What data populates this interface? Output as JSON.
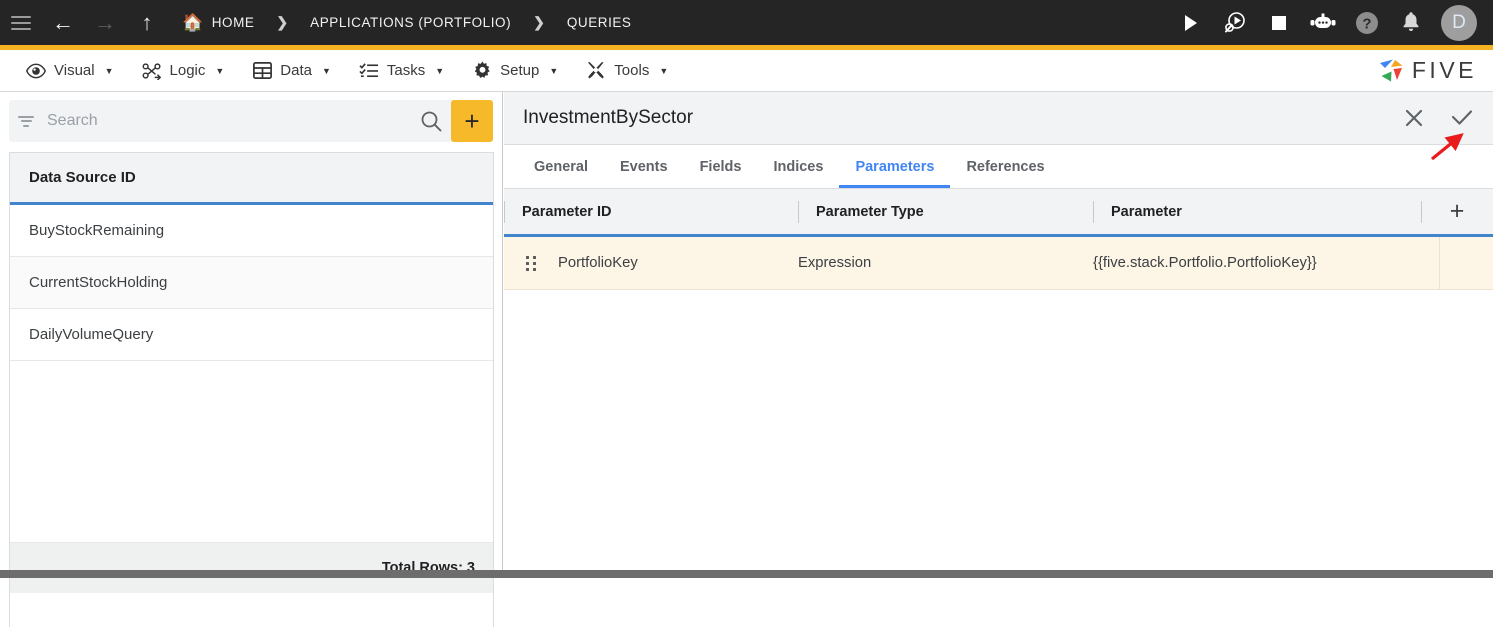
{
  "topbar": {
    "menu_icon": "hamburger-icon",
    "nav": {
      "back": "←",
      "forward": "→",
      "up": "↑"
    },
    "breadcrumb": [
      {
        "label": "HOME",
        "icon": "home-icon"
      },
      {
        "label": "APPLICATIONS (PORTFOLIO)",
        "icon": ""
      },
      {
        "label": "QUERIES",
        "icon": ""
      }
    ],
    "separator": "❯",
    "actions": [
      {
        "name": "run-icon",
        "glyph": ""
      },
      {
        "name": "debug-icon",
        "glyph": ""
      },
      {
        "name": "stop-icon",
        "glyph": ""
      },
      {
        "name": "chatbot-icon",
        "glyph": ""
      },
      {
        "name": "help-icon",
        "glyph": "?"
      },
      {
        "name": "notifications-icon",
        "glyph": ""
      }
    ],
    "avatar_initial": "D"
  },
  "menubar": {
    "items": [
      {
        "label": "Visual",
        "icon": "eye-icon",
        "caret": "▼"
      },
      {
        "label": "Logic",
        "icon": "logic-nodes-icon",
        "caret": "▼"
      },
      {
        "label": "Data",
        "icon": "table-icon",
        "caret": "▼"
      },
      {
        "label": "Tasks",
        "icon": "checklist-icon",
        "caret": "▼"
      },
      {
        "label": "Setup",
        "icon": "gear-icon",
        "caret": "▼"
      },
      {
        "label": "Tools",
        "icon": "wrench-screwdriver-icon",
        "caret": "▼"
      }
    ],
    "brand": "FIVE",
    "brand_colors": [
      "#4285f4",
      "#f5a623",
      "#34a853",
      "#ea4335"
    ]
  },
  "sidebar": {
    "search": {
      "value": "",
      "placeholder": "Search",
      "filter_icon": "filter-icon",
      "search_icon": "search-icon"
    },
    "add_button_label": "+",
    "accent_color": "#f6b929",
    "table": {
      "column_header": "Data Source ID",
      "rows": [
        {
          "name": "BuyStockRemaining"
        },
        {
          "name": "CurrentStockHolding"
        },
        {
          "name": "DailyVolumeQuery"
        }
      ],
      "footer": "Total Rows: 3"
    }
  },
  "main": {
    "title": "InvestmentBySector",
    "close_label": "✕",
    "save_label": "✓",
    "tabs": [
      {
        "label": "General",
        "active": false
      },
      {
        "label": "Events",
        "active": false
      },
      {
        "label": "Fields",
        "active": false
      },
      {
        "label": "Indices",
        "active": false
      },
      {
        "label": "Parameters",
        "active": true
      },
      {
        "label": "References",
        "active": false
      }
    ],
    "active_tab_color": "#4285f4",
    "parameters_table": {
      "columns": [
        "Parameter ID",
        "Parameter Type",
        "Parameter"
      ],
      "add_label": "+",
      "rows": [
        {
          "parameter_id": "PortfolioKey",
          "parameter_type": "Expression",
          "parameter": "{{five.stack.Portfolio.PortfolioKey}}",
          "highlight_color": "#fdf5e6"
        }
      ]
    }
  },
  "annotation": {
    "arrow_color": "#e81c1c",
    "points_to": "save-button"
  }
}
